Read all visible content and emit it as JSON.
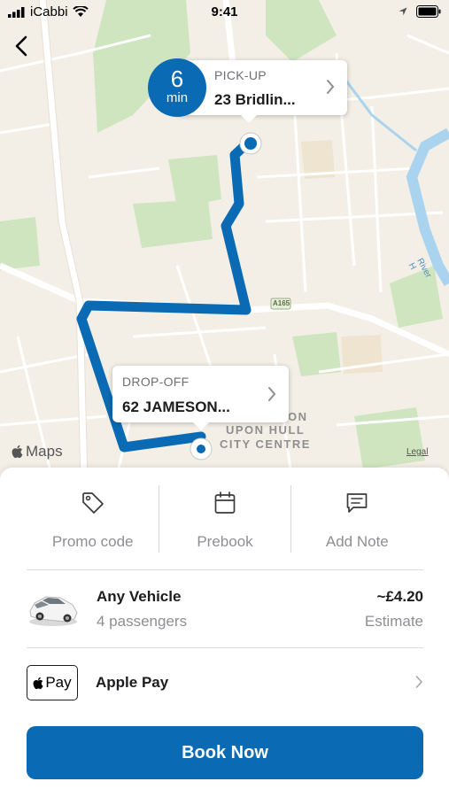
{
  "status_bar": {
    "carrier": "iCabbi",
    "time": "9:41"
  },
  "map": {
    "eta_value": "6",
    "eta_unit": "min",
    "pickup": {
      "label": "PICK-UP",
      "address": "23 Bridlin..."
    },
    "dropoff": {
      "label": "DROP-OFF",
      "address": "62 JAMESON..."
    },
    "place_labels": [
      "UPON HULL",
      "CITY CENTRE",
      "ON"
    ],
    "road_label": "A165",
    "river_label": "River H",
    "attribution": "Maps",
    "legal": "Legal",
    "route_color": "#0a6ab3"
  },
  "actions": [
    {
      "label": "Promo code",
      "icon": "tag-icon"
    },
    {
      "label": "Prebook",
      "icon": "calendar-icon"
    },
    {
      "label": "Add Note",
      "icon": "note-icon"
    }
  ],
  "vehicle": {
    "name": "Any Vehicle",
    "passengers": "4 passengers",
    "price": "~£4.20",
    "price_note": "Estimate",
    "icon": "car-icon"
  },
  "payment": {
    "badge": "Pay",
    "name": "Apple Pay"
  },
  "book_button": "Book Now",
  "colors": {
    "primary": "#0a6ab3"
  }
}
